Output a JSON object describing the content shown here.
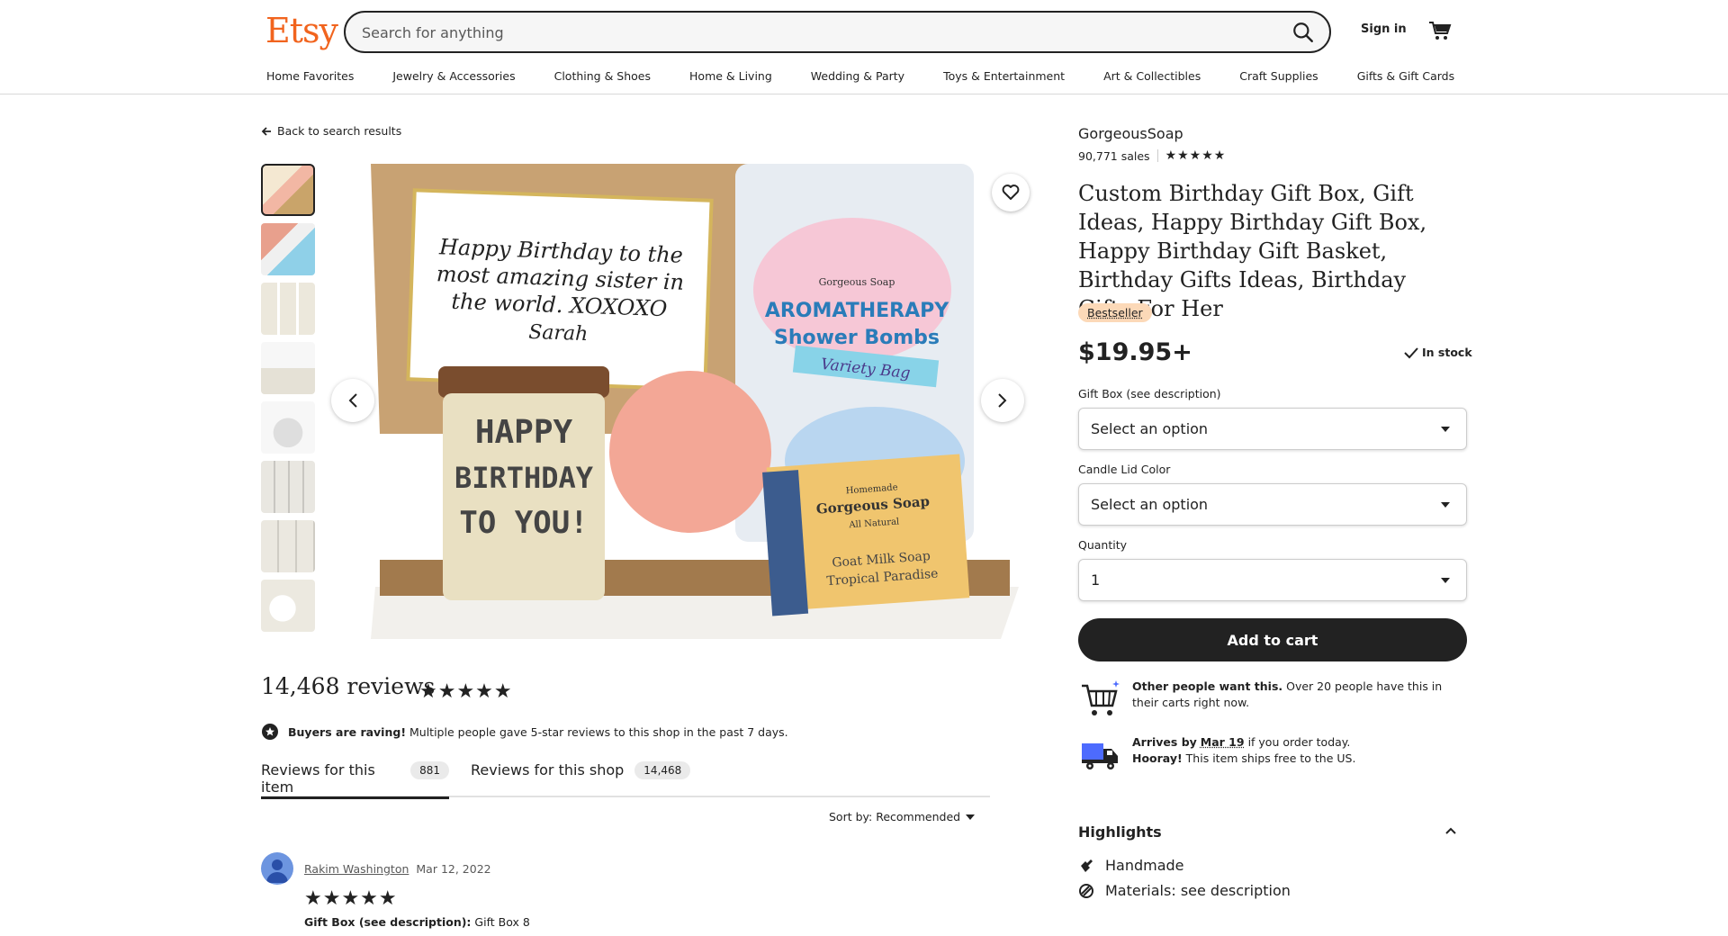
{
  "header": {
    "logo": "Etsy",
    "search_placeholder": "Search for anything",
    "sign_in": "Sign in",
    "nav": [
      "Home Favorites",
      "Jewelry & Accessories",
      "Clothing & Shoes",
      "Home & Living",
      "Wedding & Party",
      "Toys & Entertainment",
      "Art & Collectibles",
      "Craft Supplies",
      "Gifts & Gift Cards"
    ]
  },
  "back_link": "Back to search results",
  "image": {
    "card_text": [
      "Happy Birthday to the",
      "most amazing sister in",
      "the world. XOXOXO",
      "Sarah"
    ],
    "candle_text": [
      "HAPPY",
      "BIRTHDAY",
      "TO YOU!"
    ],
    "bag_text": [
      "Gorgeous Soap",
      "AROMATHERAPY",
      "Shower Bombs",
      "Variety Bag"
    ],
    "soap_text": [
      "Homemade",
      "Gorgeous Soap",
      "All Natural",
      "Goat Milk Soap",
      "Tropical Paradise"
    ]
  },
  "reviews": {
    "title": "14,468 reviews",
    "stars": "★★★★★",
    "raving_bold": "Buyers are raving!",
    "raving_text": " Multiple people gave 5-star reviews to this shop in the past 7 days.",
    "tab_item_label": "Reviews for this item",
    "tab_item_count": "881",
    "tab_shop_label": "Reviews for this shop",
    "tab_shop_count": "14,468",
    "sort": "Sort by: Recommended",
    "first": {
      "name": "Rakim Washington",
      "date": "Mar 12, 2022",
      "stars": "★★★★★",
      "option_label": "Gift Box (see description):",
      "option_value": " Gift Box 8"
    }
  },
  "product": {
    "shop": "GorgeousSoap",
    "sales": "90,771 sales",
    "shop_stars": "★★★★★",
    "title": "Custom Birthday Gift Box, Gift Ideas, Happy Birthday Gift Box, Happy Birthday Gift Basket, Birthday Gifts Ideas, Birthday Gifts For Her",
    "badge": "Bestseller",
    "price": "$19.95+",
    "stock": "In stock",
    "gift_box_label": "Gift Box (see description)",
    "gift_box_value": "Select an option",
    "lid_label": "Candle Lid Color",
    "lid_value": "Select an option",
    "qty_label": "Quantity",
    "qty_value": "1",
    "add_to_cart": "Add to cart",
    "want_bold": "Other people want this.",
    "want_text": " Over 20 people have this in their carts right now.",
    "arrives_bold": "Arrives by",
    "arrives_date": "Mar 19",
    "arrives_text": " if you order today.",
    "hooray_bold": "Hooray!",
    "hooray_text": " This item ships free to the US.",
    "highlights_title": "Highlights",
    "highlight_1": "Handmade",
    "highlight_2": "Materials: see description"
  },
  "colors": {
    "brand": "#f1641e",
    "badge": "#fcd9b8",
    "dark": "#222222"
  }
}
